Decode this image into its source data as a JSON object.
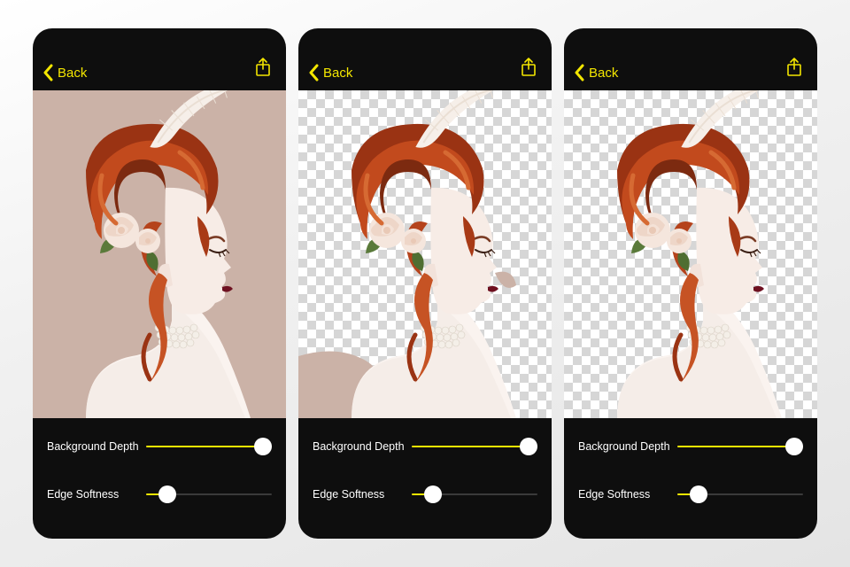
{
  "accent": "#f3e600",
  "screens": [
    {
      "back_label": "Back",
      "background_mode": "solid",
      "sliders": {
        "background_depth": {
          "label": "Background Depth",
          "value": 100
        },
        "edge_softness": {
          "label": "Edge Softness",
          "value": 17
        }
      }
    },
    {
      "back_label": "Back",
      "background_mode": "transparent_partial",
      "sliders": {
        "background_depth": {
          "label": "Background Depth",
          "value": 100
        },
        "edge_softness": {
          "label": "Edge Softness",
          "value": 17
        }
      }
    },
    {
      "back_label": "Back",
      "background_mode": "transparent_full",
      "sliders": {
        "background_depth": {
          "label": "Background Depth",
          "value": 100
        },
        "edge_softness": {
          "label": "Edge Softness",
          "value": 17
        }
      }
    }
  ]
}
